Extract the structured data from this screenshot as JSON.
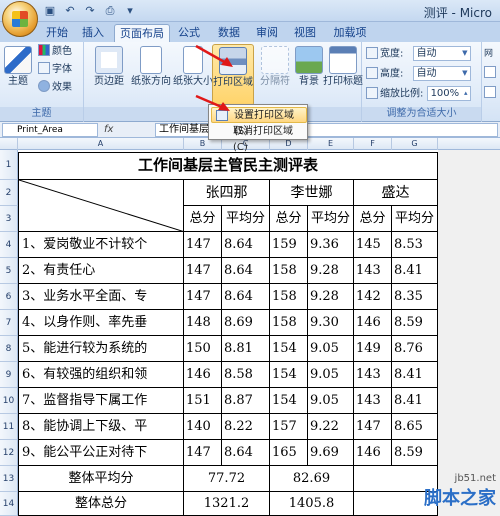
{
  "window": {
    "title": "测评 - Micro"
  },
  "quick_access": {
    "save_icon": "save-icon",
    "undo_icon": "undo-icon",
    "redo_icon": "redo-icon"
  },
  "tabs": [
    "开始",
    "插入",
    "页面布局",
    "公式",
    "数据",
    "审阅",
    "视图",
    "加载项"
  ],
  "active_tab": "页面布局",
  "ribbon": {
    "theme_group": {
      "label": "主题",
      "themes_btn": "主题",
      "colors": "颜色",
      "fonts": "字体",
      "effects": "效果"
    },
    "page_setup_group": {
      "label": "页",
      "margins": "页边距",
      "orientation": "纸张方向",
      "size": "纸张大小",
      "print_area": "打印区域",
      "breaks": "分隔符",
      "background": "背景",
      "print_titles": "打印标题"
    },
    "scale_group": {
      "label": "调整为合适大小",
      "width_label": "宽度:",
      "width_value": "自动",
      "height_label": "高度:",
      "height_value": "自动",
      "scale_label": "缩放比例:",
      "scale_value": "100%"
    },
    "sheet_options_group": {
      "label": "网"
    }
  },
  "print_area_menu": {
    "set": "设置打印区域(S)",
    "clear": "取消打印区域(C)"
  },
  "formula_bar": {
    "name_box": "Print_Area",
    "fx": "fx",
    "formula": "工作间基层主"
  },
  "columns": [
    "A",
    "B",
    "C",
    "D",
    "E",
    "F",
    "G"
  ],
  "rows": [
    "1",
    "2",
    "3",
    "4",
    "5",
    "6",
    "7",
    "8",
    "9",
    "10",
    "11",
    "12",
    "13",
    "14"
  ],
  "sheet": {
    "title": "工作间基层主管民主测评表",
    "people": [
      "张四那",
      "李世娜",
      "盛达"
    ],
    "sub_headers": [
      "总分",
      "平均分",
      "总分",
      "平均分",
      "总分",
      "平均分"
    ],
    "items": [
      {
        "label": "1、爱岗敬业不计较个",
        "values": [
          "147",
          "8.64",
          "159",
          "9.36",
          "145",
          "8.53"
        ]
      },
      {
        "label": "2、有责任心",
        "values": [
          "147",
          "8.64",
          "158",
          "9.28",
          "143",
          "8.41"
        ]
      },
      {
        "label": "3、业务水平全面、专",
        "values": [
          "147",
          "8.64",
          "158",
          "9.28",
          "142",
          "8.35"
        ]
      },
      {
        "label": "4、以身作则、率先垂",
        "values": [
          "148",
          "8.69",
          "158",
          "9.30",
          "146",
          "8.59"
        ]
      },
      {
        "label": "5、能进行较为系统的",
        "values": [
          "150",
          "8.81",
          "154",
          "9.05",
          "149",
          "8.76"
        ]
      },
      {
        "label": "6、有较强的组织和领",
        "values": [
          "146",
          "8.58",
          "154",
          "9.05",
          "143",
          "8.41"
        ]
      },
      {
        "label": "7、监督指导下属工作",
        "values": [
          "151",
          "8.87",
          "154",
          "9.05",
          "143",
          "8.41"
        ]
      },
      {
        "label": "8、能协调上下级、平",
        "values": [
          "140",
          "8.22",
          "157",
          "9.22",
          "147",
          "8.65"
        ]
      },
      {
        "label": "9、能公平公正对待下",
        "values": [
          "147",
          "8.64",
          "165",
          "9.69",
          "146",
          "8.59"
        ]
      }
    ],
    "overall_avg_label": "整体平均分",
    "overall_avg": [
      "77.72",
      "82.69"
    ],
    "overall_total_label": "整体总分",
    "overall_total": [
      "1321.2",
      "1405.8"
    ]
  },
  "watermark": {
    "url": "jb51.net",
    "name": "脚本之家"
  }
}
